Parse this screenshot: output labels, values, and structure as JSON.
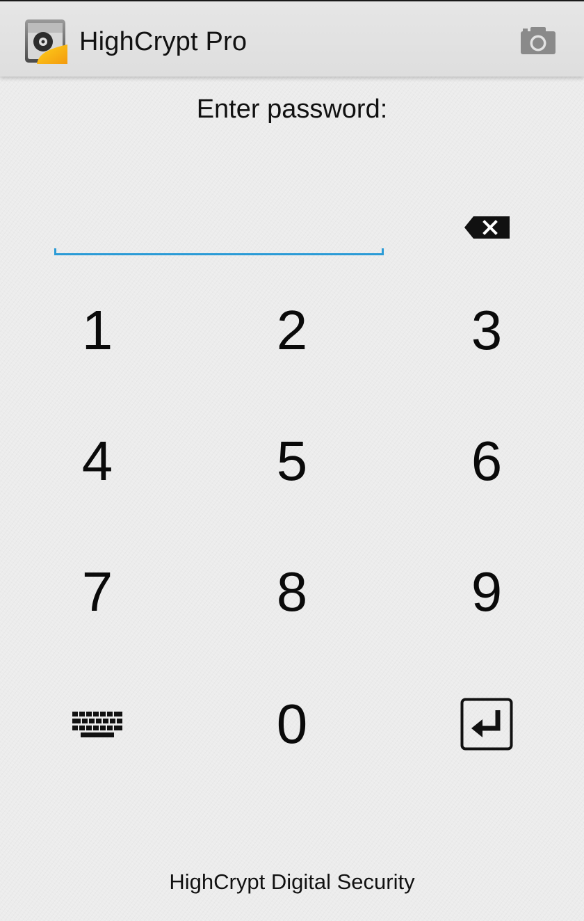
{
  "app": {
    "title": "HighCrypt Pro"
  },
  "icons": {
    "app": "highcrypt-app-icon",
    "camera": "camera-icon",
    "backspace": "backspace-icon",
    "keyboard": "keyboard-icon",
    "enter": "enter-icon"
  },
  "prompt": "Enter password:",
  "password_field": {
    "value": "",
    "placeholder": ""
  },
  "keypad": {
    "keys": [
      "1",
      "2",
      "3",
      "4",
      "5",
      "6",
      "7",
      "8",
      "9",
      "0"
    ]
  },
  "footer": "HighCrypt Digital Security",
  "colors": {
    "accent": "#2b9bd6",
    "action_bar": "#e3e3e3",
    "background": "#ececec",
    "icon_gray": "#8a8a8a"
  }
}
